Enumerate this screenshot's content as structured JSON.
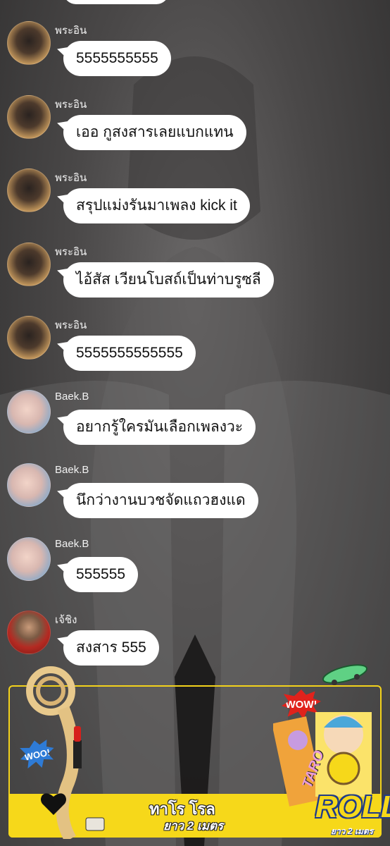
{
  "messages": [
    {
      "user": "พระอิน",
      "text": "5555555555",
      "avatar": "dark"
    },
    {
      "user": "พระอิน",
      "text": "เออ กูสงสารเลยแบกแทน",
      "avatar": "dark"
    },
    {
      "user": "พระอิน",
      "text": "สรุปแม่งรันมาเพลง kick it",
      "avatar": "dark"
    },
    {
      "user": "พระอิน",
      "text": "ไอ้สัส เวียนโบสถ์เป็นท่าบรูซลี",
      "avatar": "dark"
    },
    {
      "user": "พระอิน",
      "text": "5555555555555",
      "avatar": "dark"
    },
    {
      "user": "Baek.B",
      "text": "อยากรู้ใครมันเลือกเพลงวะ",
      "avatar": "pale"
    },
    {
      "user": "Baek.B",
      "text": "นึกว่างานบวชจัดแถวฮงแด",
      "avatar": "pale"
    },
    {
      "user": "Baek.B",
      "text": "555555",
      "avatar": "pale"
    },
    {
      "user": "เจ้ชิง",
      "text": "สงสาร 555",
      "avatar": "red"
    }
  ],
  "ad": {
    "title": "ทาโร โรล",
    "subtitle": "ยาว 2 เมตร",
    "brand": "ROLL",
    "brand_sub": "ยาว 2 เมตร",
    "wow_badge": "WOW!",
    "woo_badge": "WOO!",
    "flavor": "TARO",
    "accent_color": "#f6d81a"
  }
}
